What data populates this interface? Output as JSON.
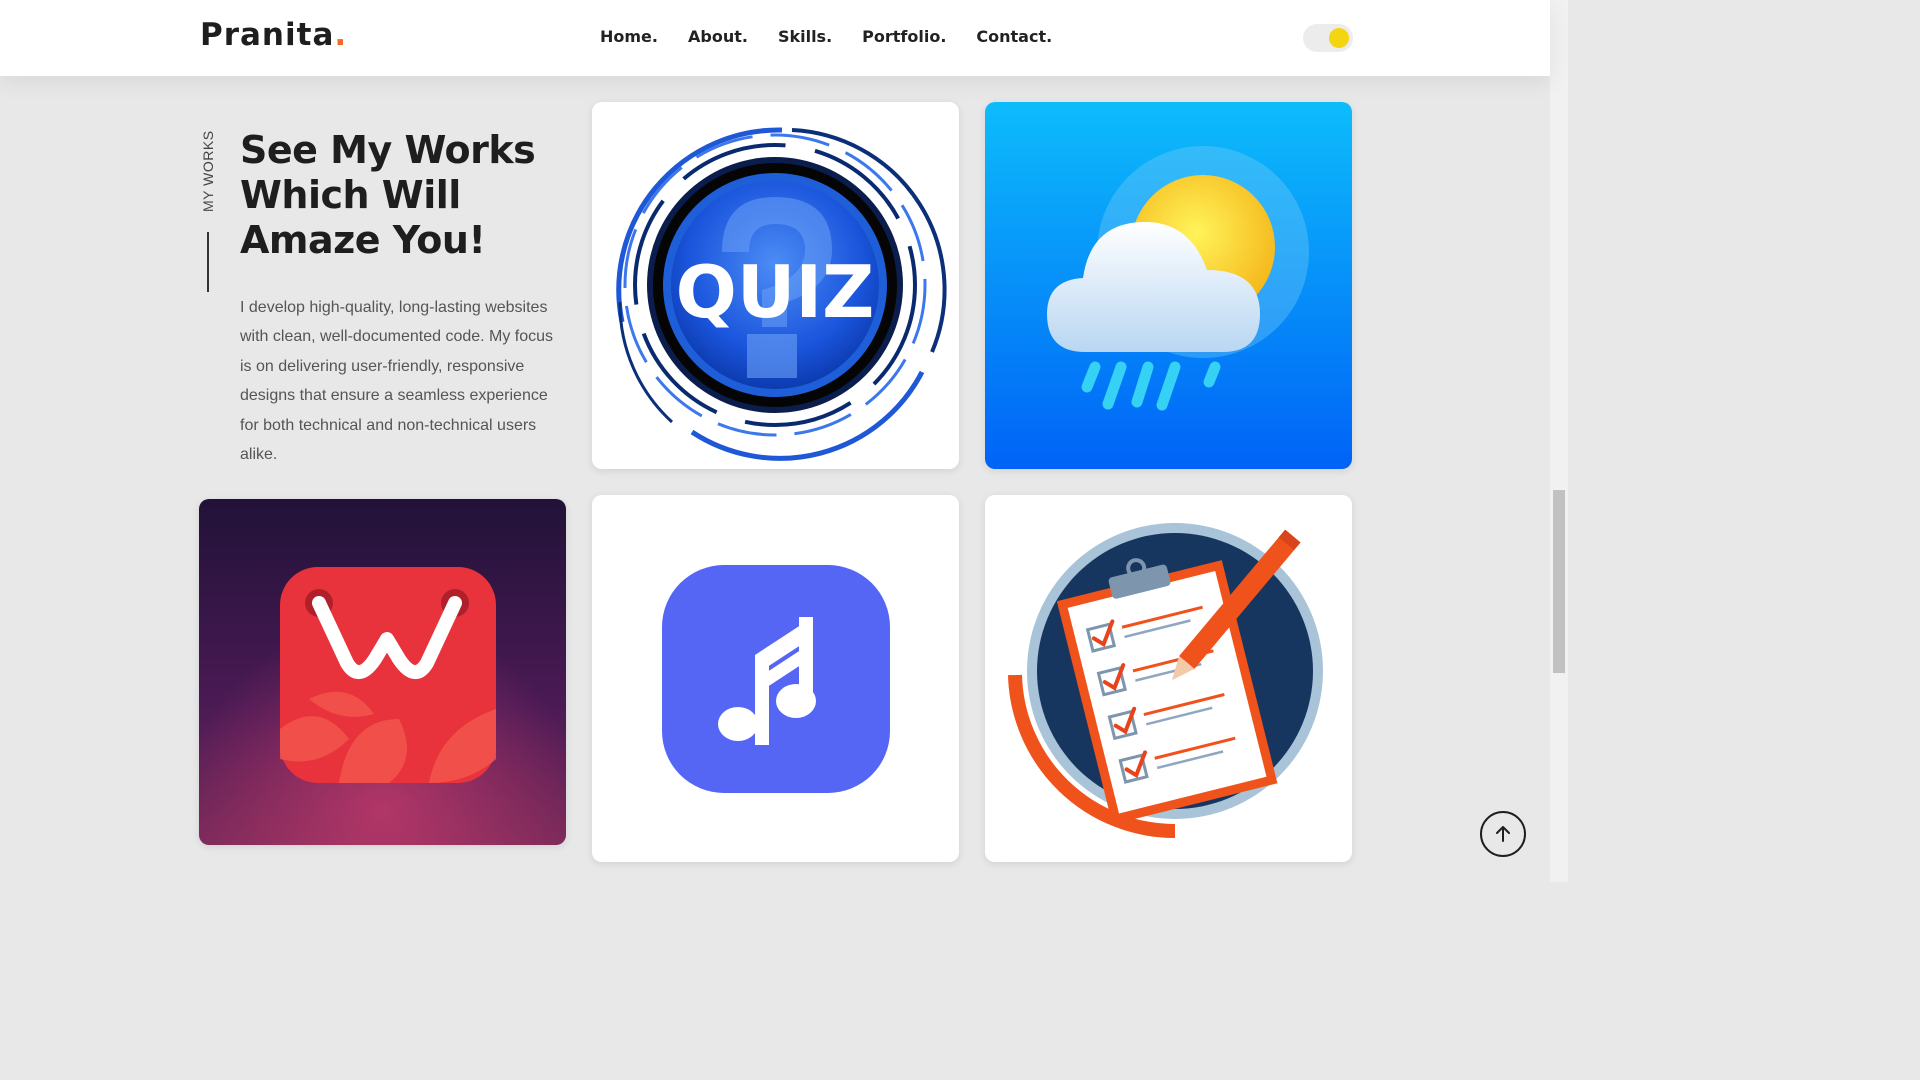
{
  "header": {
    "logo_text": "Pranita",
    "logo_dot": ".",
    "nav": [
      "Home.",
      "About.",
      "Skills.",
      "Portfolio.",
      "Contact."
    ]
  },
  "theme_toggle": {
    "icon": "sun-icon",
    "knob_color": "#f4d511"
  },
  "works": {
    "label": "MY WORKS",
    "title": "See My Works Which Will Amaze You!",
    "description": "I develop high-quality, long-lasting websites with clean, well-documented code. My focus is on delivering user-friendly, responsive designs that ensure a seamless experience for both technical and non-technical users alike."
  },
  "portfolio": [
    {
      "name": "quiz-app-thumbnail",
      "icon": "quiz-icon",
      "text": "QUIZ"
    },
    {
      "name": "weather-app-thumbnail",
      "icon": "weather-icon"
    },
    {
      "name": "wishlist-app-thumbnail",
      "icon": "wishlist-icon"
    },
    {
      "name": "music-app-thumbnail",
      "icon": "music-note-icon"
    },
    {
      "name": "todo-app-thumbnail",
      "icon": "checklist-icon"
    }
  ],
  "back_to_top": {
    "icon": "arrow-up-icon"
  },
  "colors": {
    "accent": "#f26b21",
    "background": "#e8e8e8",
    "text_dark": "#1e1e1e",
    "music_purple": "#5566f5",
    "weather_blue": "#0aa8f8",
    "wish_red": "#e8323c"
  }
}
